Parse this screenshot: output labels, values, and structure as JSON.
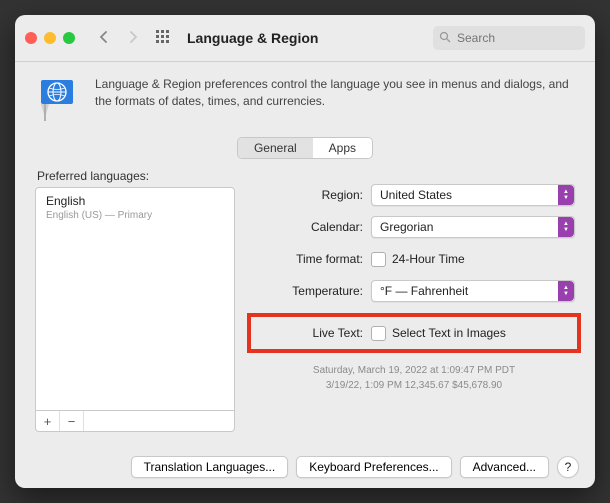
{
  "window": {
    "title": "Language & Region"
  },
  "search": {
    "placeholder": "Search"
  },
  "header": {
    "description": "Language & Region preferences control the language you see in menus and dialogs, and the formats of dates, times, and currencies."
  },
  "tabs": {
    "general": "General",
    "apps": "Apps"
  },
  "languages": {
    "label": "Preferred languages:",
    "items": [
      {
        "name": "English",
        "detail": "English (US) — Primary"
      }
    ]
  },
  "settings": {
    "region_label": "Region:",
    "region_value": "United States",
    "calendar_label": "Calendar:",
    "calendar_value": "Gregorian",
    "timeformat_label": "Time format:",
    "timeformat_value": "24-Hour Time",
    "temperature_label": "Temperature:",
    "temperature_value": "°F — Fahrenheit",
    "livetext_label": "Live Text:",
    "livetext_option": "Select Text in Images"
  },
  "sample": {
    "line1": "Saturday, March 19, 2022 at 1:09:47 PM PDT",
    "line2": "3/19/22, 1:09 PM    12,345.67    $45,678.90"
  },
  "footer": {
    "translation": "Translation Languages...",
    "keyboard": "Keyboard Preferences...",
    "advanced": "Advanced...",
    "help": "?"
  }
}
